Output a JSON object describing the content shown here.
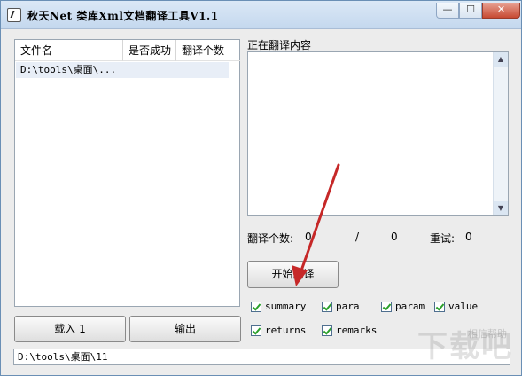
{
  "window": {
    "title": "秋天Net 类库Xml文档翻译工具V1.1",
    "minimize": "—",
    "maximize": "☐",
    "close": "✕"
  },
  "file_list": {
    "columns": [
      "文件名",
      "是否成功",
      "翻译个数"
    ],
    "rows": [
      {
        "file": "D:\\tools\\桌面\\...",
        "success": "",
        "count": ""
      }
    ]
  },
  "buttons": {
    "load": "载入 1",
    "output": "输出",
    "start": "开始翻译"
  },
  "status_path": "D:\\tools\\桌面\\11",
  "translating": {
    "label": "正在翻译内容",
    "value": "—",
    "content": ""
  },
  "stats": {
    "count_label": "翻译个数:",
    "count_done": "0",
    "separator": "/",
    "count_total": "0",
    "retry_label": "重试:",
    "retry_value": "0"
  },
  "options": [
    {
      "label": "summary",
      "checked": true
    },
    {
      "label": "para",
      "checked": true
    },
    {
      "label": "param",
      "checked": true
    },
    {
      "label": "value",
      "checked": true
    },
    {
      "label": "returns",
      "checked": true
    },
    {
      "label": "remarks",
      "checked": true
    }
  ],
  "watermark": {
    "text": "下载吧",
    "small": "相信帮助"
  },
  "colors": {
    "arrow": "#c62828",
    "check": "#2aa02a",
    "title_bg": "#c4d8ee"
  }
}
